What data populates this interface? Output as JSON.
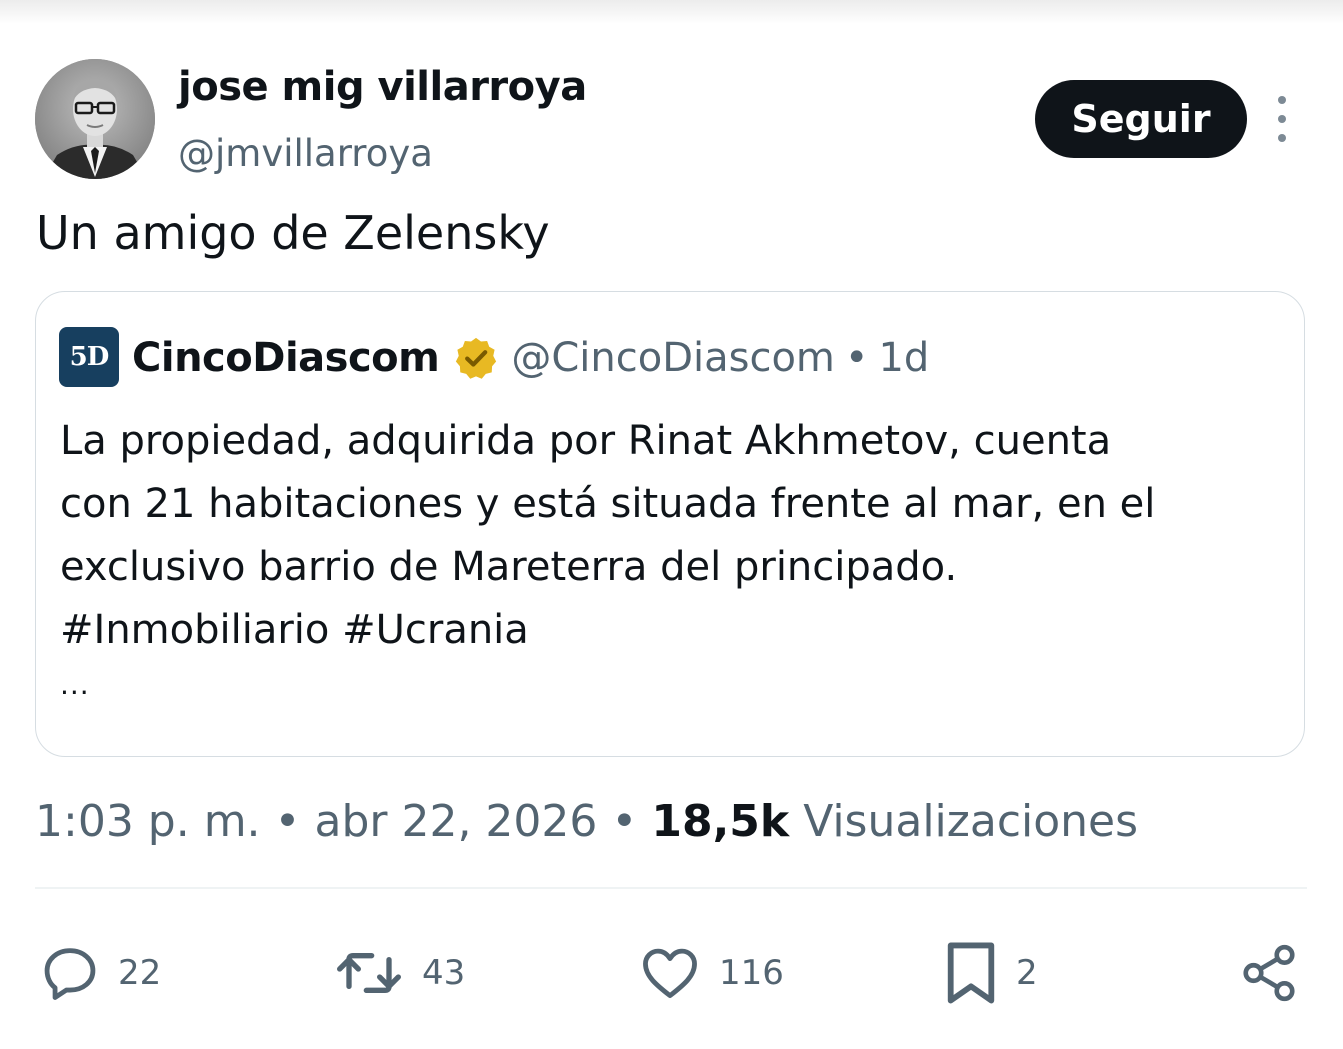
{
  "author": {
    "display_name": "jose mig villarroya",
    "handle": "@jmvillarroya",
    "follow_label": "Seguir"
  },
  "tweet": {
    "text": "Un amigo de Zelensky"
  },
  "quoted": {
    "logo_text": "5D",
    "name": "CincoDiascom",
    "handle": "@CincoDiascom",
    "separator": "•",
    "time": "1d",
    "body_lines": [
      "La propiedad, adquirida por Rinat Akhmetov, cuenta",
      "con 21 habitaciones y está situada frente al mar, en el",
      "exclusivo barrio de Mareterra del principado.",
      "#Inmobiliario #Ucrania"
    ],
    "ellipsis": "..."
  },
  "meta": {
    "time": "1:03 p. m.",
    "dot": "•",
    "date": "abr 22, 2026",
    "views_count": "18,5k",
    "views_label": "Visualizaciones"
  },
  "actions": {
    "replies": "22",
    "reposts": "43",
    "likes": "116",
    "bookmarks": "2"
  },
  "colors": {
    "text_primary": "#0f1419",
    "text_secondary": "#536471",
    "follow_button_bg": "#0f1419",
    "verified_badge": "#e8b923",
    "logo_bg": "#173f5f",
    "divider": "#eff3f4",
    "card_border": "#d6dde2"
  },
  "icons": [
    "more-icon",
    "verified-badge-icon",
    "reply-icon",
    "repost-icon",
    "like-icon",
    "bookmark-icon",
    "share-icon"
  ]
}
